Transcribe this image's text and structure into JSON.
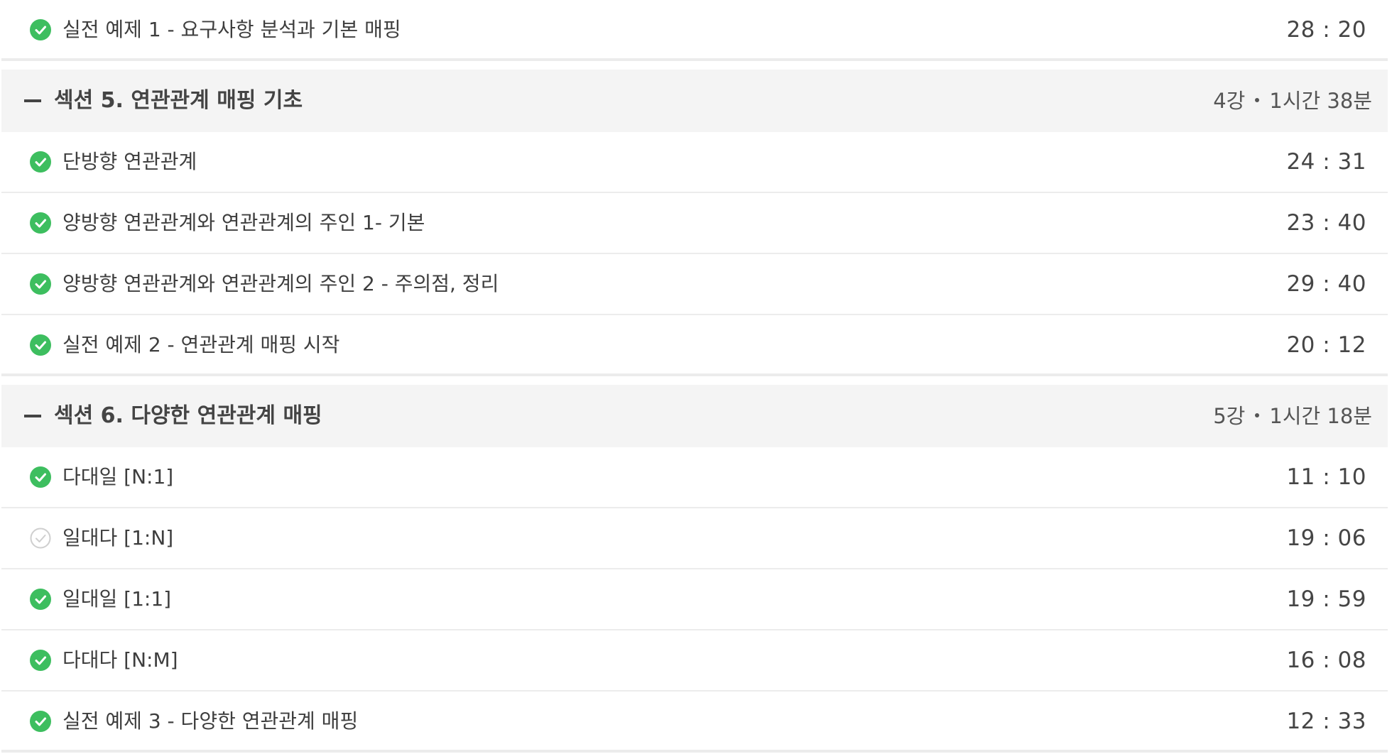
{
  "colors": {
    "complete": "#3dbe5f",
    "incomplete": "#cfcfcf",
    "header_bg": "#f4f4f4",
    "divider": "#ececec"
  },
  "top_lesson": {
    "title": "실전 예제 1 - 요구사항 분석과 기본 매핑",
    "time": "28 : 20",
    "status": "complete",
    "icon": "check-circle-icon"
  },
  "sections": [
    {
      "title": "섹션 5. 연관관계 매핑 기초",
      "count": "4강",
      "duration": "1시간 38분",
      "lessons": [
        {
          "title": "단방향 연관관계",
          "time": "24 : 31",
          "status": "complete"
        },
        {
          "title": "양방향 연관관계와 연관관계의 주인 1- 기본",
          "time": "23 : 40",
          "status": "complete"
        },
        {
          "title": "양방향 연관관계와 연관관계의 주인 2 - 주의점, 정리",
          "time": "29 : 40",
          "status": "complete"
        },
        {
          "title": "실전 예제 2 - 연관관계 매핑 시작",
          "time": "20 : 12",
          "status": "complete"
        }
      ]
    },
    {
      "title": "섹션 6. 다양한 연관관계 매핑",
      "count": "5강",
      "duration": "1시간 18분",
      "lessons": [
        {
          "title": "다대일 [N:1]",
          "time": "11 : 10",
          "status": "complete"
        },
        {
          "title": "일대다 [1:N]",
          "time": "19 : 06",
          "status": "incomplete"
        },
        {
          "title": "일대일 [1:1]",
          "time": "19 : 59",
          "status": "complete"
        },
        {
          "title": "다대다 [N:M]",
          "time": "16 : 08",
          "status": "complete"
        },
        {
          "title": "실전 예제 3 - 다양한 연관관계 매핑",
          "time": "12 : 33",
          "status": "complete"
        }
      ]
    }
  ]
}
